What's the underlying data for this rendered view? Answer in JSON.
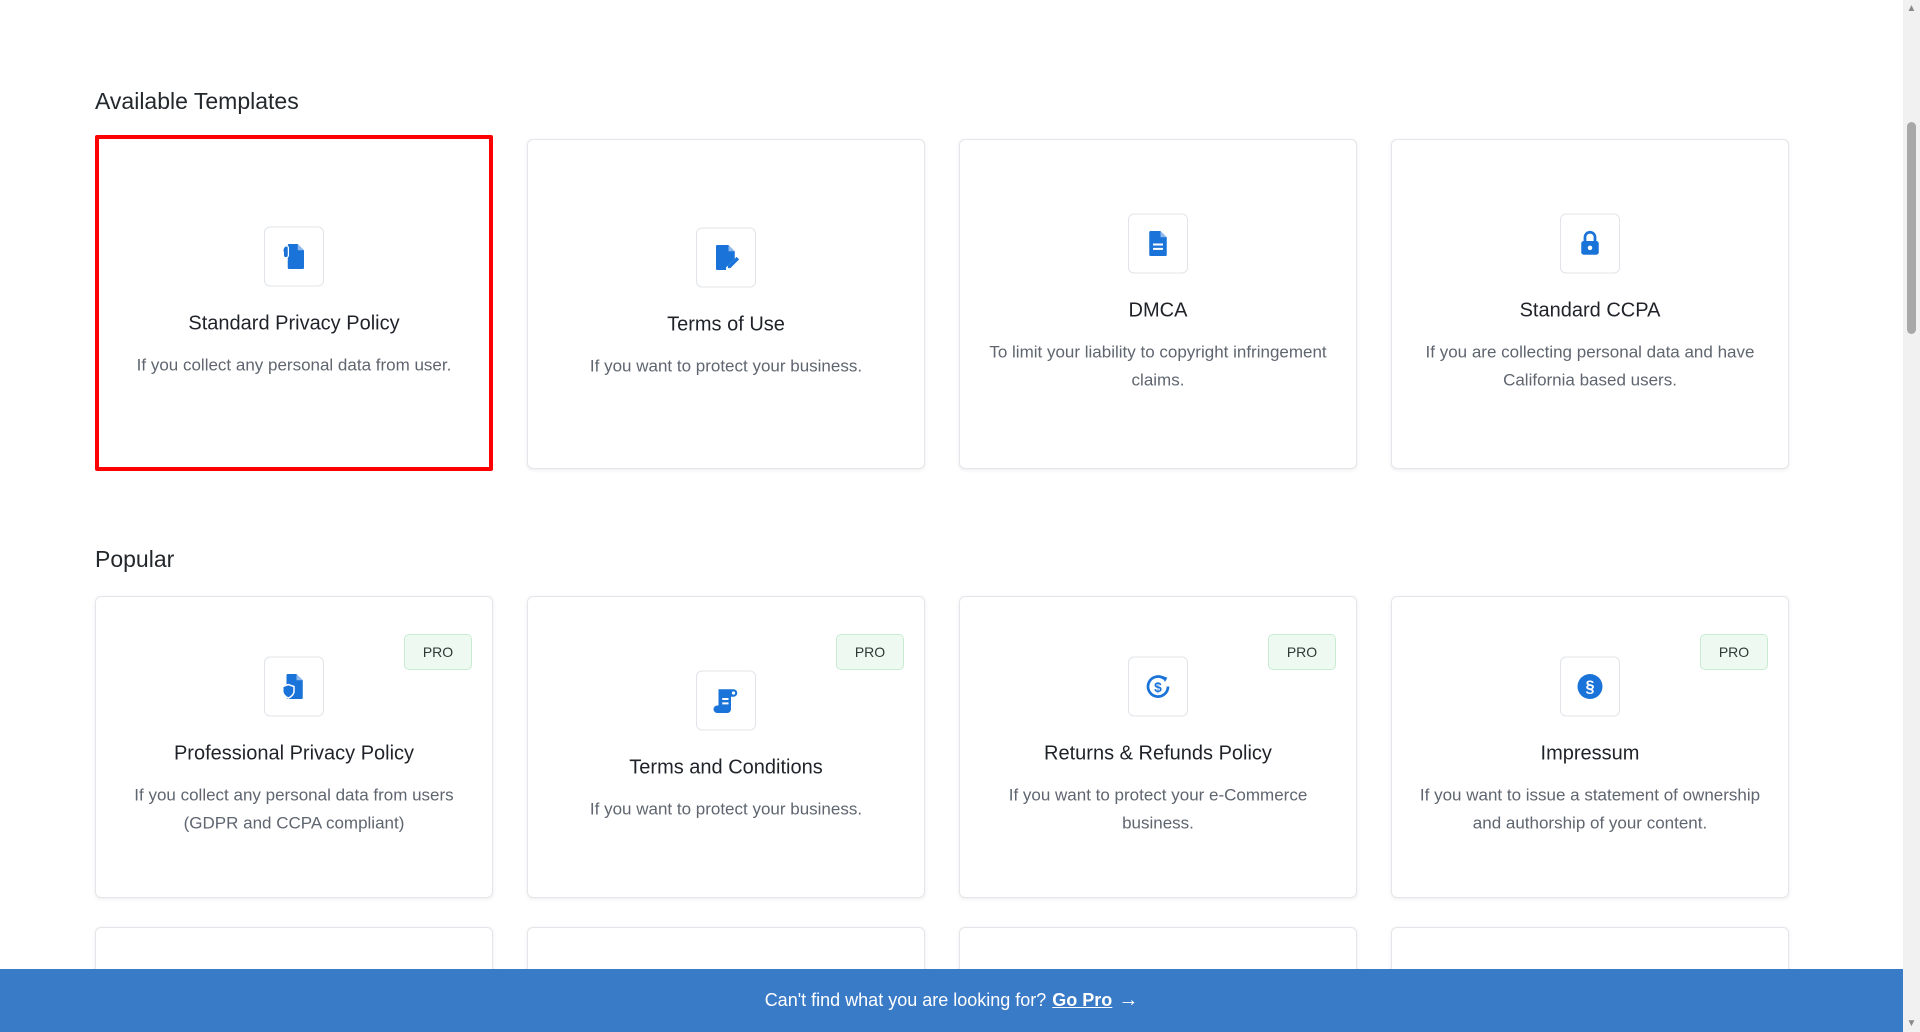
{
  "available": {
    "title": "Available Templates",
    "cards": [
      {
        "title": "Standard Privacy Policy",
        "desc": "If you collect any personal data from user.",
        "icon": "privacy-document-icon"
      },
      {
        "title": "Terms of Use",
        "desc": "If you want to protect your business.",
        "icon": "document-edit-icon"
      },
      {
        "title": "DMCA",
        "desc": "To limit your liability to copyright infringement claims.",
        "icon": "document-lines-icon"
      },
      {
        "title": "Standard CCPA",
        "desc": "If you are collecting personal data and have California based users.",
        "icon": "lock-icon"
      }
    ]
  },
  "popular": {
    "title": "Popular",
    "badge": "PRO",
    "cards": [
      {
        "title": "Professional Privacy Policy",
        "desc": "If you collect any personal data from users (GDPR and CCPA compliant)",
        "icon": "shield-document-icon"
      },
      {
        "title": "Terms and Conditions",
        "desc": "If you want to protect your business.",
        "icon": "scroll-icon"
      },
      {
        "title": "Returns & Refunds Policy",
        "desc": "If you want to protect your e-Commerce business.",
        "icon": "refund-dollar-icon"
      },
      {
        "title": "Impressum",
        "desc": "If you want to issue a statement of ownership and authorship of your content.",
        "icon": "section-sign-icon"
      }
    ]
  },
  "bottom_bar": {
    "text": "Can't find what you are looking for?",
    "link": "Go Pro",
    "arrow": "→"
  },
  "colors": {
    "accent": "#1a73d9",
    "bar": "#3a7bc8",
    "selected_border": "#ff0000",
    "pro_bg": "#eefaf1"
  }
}
